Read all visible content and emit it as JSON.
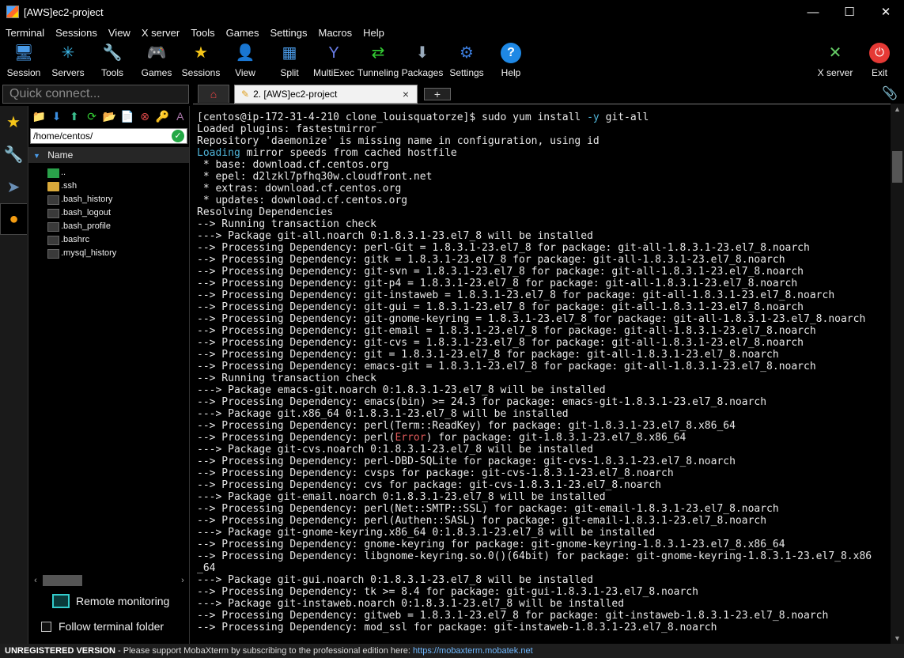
{
  "window": {
    "title": "[AWS]ec2-project",
    "minimize": "—",
    "maximize": "☐",
    "close": "✕"
  },
  "menu": [
    "Terminal",
    "Sessions",
    "View",
    "X server",
    "Tools",
    "Games",
    "Settings",
    "Macros",
    "Help"
  ],
  "toolbar": {
    "session": "Session",
    "servers": "Servers",
    "tools": "Tools",
    "games": "Games",
    "sessions": "Sessions",
    "view": "View",
    "split": "Split",
    "multiexec": "MultiExec",
    "tunneling": "Tunneling",
    "packages": "Packages",
    "settings": "Settings",
    "help": "Help",
    "xserver": "X server",
    "exit": "Exit"
  },
  "quick_connect": {
    "placeholder": "Quick connect..."
  },
  "sidebar": {
    "path": "/home/centos/",
    "column_header": "Name",
    "files": [
      {
        "name": "..",
        "type": "up"
      },
      {
        "name": ".ssh",
        "type": "folder"
      },
      {
        "name": ".bash_history",
        "type": "file"
      },
      {
        "name": ".bash_logout",
        "type": "file"
      },
      {
        "name": ".bash_profile",
        "type": "file"
      },
      {
        "name": ".bashrc",
        "type": "file"
      },
      {
        "name": ".mysql_history",
        "type": "file"
      }
    ],
    "remote_monitoring": "Remote monitoring",
    "follow_folder": "Follow terminal folder"
  },
  "tabs": {
    "session_tab": "2. [AWS]ec2-project",
    "add": "+"
  },
  "terminal": {
    "lines": [
      "[centos@ip-172-31-4-210 clone_louisquatorze]$ sudo yum install -y git-all",
      "Loaded plugins: fastestmirror",
      "Repository 'daemonize' is missing name in configuration, using id",
      "Loading mirror speeds from cached hostfile",
      " * base: download.cf.centos.org",
      " * epel: d2lzkl7pfhq30w.cloudfront.net",
      " * extras: download.cf.centos.org",
      " * updates: download.cf.centos.org",
      "Resolving Dependencies",
      "--> Running transaction check",
      "---> Package git-all.noarch 0:1.8.3.1-23.el7_8 will be installed",
      "--> Processing Dependency: perl-Git = 1.8.3.1-23.el7_8 for package: git-all-1.8.3.1-23.el7_8.noarch",
      "--> Processing Dependency: gitk = 1.8.3.1-23.el7_8 for package: git-all-1.8.3.1-23.el7_8.noarch",
      "--> Processing Dependency: git-svn = 1.8.3.1-23.el7_8 for package: git-all-1.8.3.1-23.el7_8.noarch",
      "--> Processing Dependency: git-p4 = 1.8.3.1-23.el7_8 for package: git-all-1.8.3.1-23.el7_8.noarch",
      "--> Processing Dependency: git-instaweb = 1.8.3.1-23.el7_8 for package: git-all-1.8.3.1-23.el7_8.noarch",
      "--> Processing Dependency: git-gui = 1.8.3.1-23.el7_8 for package: git-all-1.8.3.1-23.el7_8.noarch",
      "--> Processing Dependency: git-gnome-keyring = 1.8.3.1-23.el7_8 for package: git-all-1.8.3.1-23.el7_8.noarch",
      "--> Processing Dependency: git-email = 1.8.3.1-23.el7_8 for package: git-all-1.8.3.1-23.el7_8.noarch",
      "--> Processing Dependency: git-cvs = 1.8.3.1-23.el7_8 for package: git-all-1.8.3.1-23.el7_8.noarch",
      "--> Processing Dependency: git = 1.8.3.1-23.el7_8 for package: git-all-1.8.3.1-23.el7_8.noarch",
      "--> Processing Dependency: emacs-git = 1.8.3.1-23.el7_8 for package: git-all-1.8.3.1-23.el7_8.noarch",
      "--> Running transaction check",
      "---> Package emacs-git.noarch 0:1.8.3.1-23.el7_8 will be installed",
      "--> Processing Dependency: emacs(bin) >= 24.3 for package: emacs-git-1.8.3.1-23.el7_8.noarch",
      "---> Package git.x86_64 0:1.8.3.1-23.el7_8 will be installed",
      "--> Processing Dependency: perl(Term::ReadKey) for package: git-1.8.3.1-23.el7_8.x86_64",
      "--> Processing Dependency: perl(Error) for package: git-1.8.3.1-23.el7_8.x86_64",
      "---> Package git-cvs.noarch 0:1.8.3.1-23.el7_8 will be installed",
      "--> Processing Dependency: perl-DBD-SQLite for package: git-cvs-1.8.3.1-23.el7_8.noarch",
      "--> Processing Dependency: cvsps for package: git-cvs-1.8.3.1-23.el7_8.noarch",
      "--> Processing Dependency: cvs for package: git-cvs-1.8.3.1-23.el7_8.noarch",
      "---> Package git-email.noarch 0:1.8.3.1-23.el7_8 will be installed",
      "--> Processing Dependency: perl(Net::SMTP::SSL) for package: git-email-1.8.3.1-23.el7_8.noarch",
      "--> Processing Dependency: perl(Authen::SASL) for package: git-email-1.8.3.1-23.el7_8.noarch",
      "---> Package git-gnome-keyring.x86_64 0:1.8.3.1-23.el7_8 will be installed",
      "--> Processing Dependency: gnome-keyring for package: git-gnome-keyring-1.8.3.1-23.el7_8.x86_64",
      "--> Processing Dependency: libgnome-keyring.so.0()(64bit) for package: git-gnome-keyring-1.8.3.1-23.el7_8.x86",
      "_64",
      "---> Package git-gui.noarch 0:1.8.3.1-23.el7_8 will be installed",
      "--> Processing Dependency: tk >= 8.4 for package: git-gui-1.8.3.1-23.el7_8.noarch",
      "---> Package git-instaweb.noarch 0:1.8.3.1-23.el7_8 will be installed",
      "--> Processing Dependency: gitweb = 1.8.3.1-23.el7_8 for package: git-instaweb-1.8.3.1-23.el7_8.noarch",
      "--> Processing Dependency: mod_ssl for package: git-instaweb-1.8.3.1-23.el7_8.noarch"
    ]
  },
  "status": {
    "label": "UNREGISTERED VERSION",
    "message": " -  Please support MobaXterm by subscribing to the professional edition here: ",
    "link": "https://mobaxterm.mobatek.net"
  },
  "colors": {
    "accent_cyan": "#4fb4d8",
    "error_red": "#e05a5a",
    "link_blue": "#6fb8ff"
  }
}
